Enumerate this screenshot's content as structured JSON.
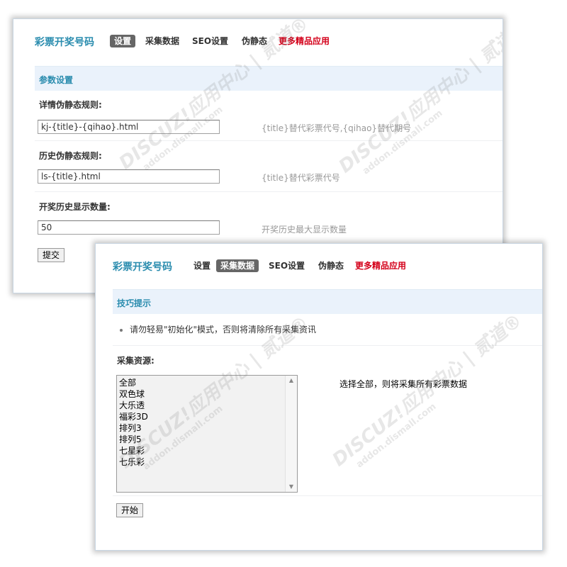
{
  "panel_settings": {
    "brand": "彩票开奖号码",
    "nav": [
      {
        "label": "设置",
        "active": true
      },
      {
        "label": "采集数据",
        "active": false
      },
      {
        "label": "SEO设置",
        "active": false
      },
      {
        "label": "伪静态",
        "active": false
      },
      {
        "label": "更多精品应用",
        "active": false,
        "promo": true
      }
    ],
    "section_title": "参数设置",
    "fields": [
      {
        "label": "详情伪静态规则:",
        "value": "kj-{title}-{qihao}.html",
        "hint": "{title}替代彩票代号,{qihao}替代期号"
      },
      {
        "label": "历史伪静态规则:",
        "value": "ls-{title}.html",
        "hint": "{title}替代彩票代号"
      },
      {
        "label": "开奖历史显示数量:",
        "value": "50",
        "hint": "开奖历史最大显示数量"
      }
    ],
    "submit_label": "提交"
  },
  "panel_collect": {
    "brand": "彩票开奖号码",
    "nav": [
      {
        "label": "设置",
        "active": false
      },
      {
        "label": "采集数据",
        "active": true
      },
      {
        "label": "SEO设置",
        "active": false
      },
      {
        "label": "伪静态",
        "active": false
      },
      {
        "label": "更多精品应用",
        "active": false,
        "promo": true
      }
    ],
    "section_title": "技巧提示",
    "tip": "请勿轻易\"初始化\"模式，否则将清除所有采集资讯",
    "source_label": "采集资源:",
    "source_options": [
      "全部",
      "双色球",
      "大乐透",
      "福彩3D",
      "排列3",
      "排列5",
      "七星彩",
      "七乐彩"
    ],
    "source_note": "选择全部，则将采集所有彩票数据",
    "start_label": "开始"
  },
  "watermark": {
    "brand": "DISCUZ!应用中心 | 贰道®",
    "url": "addon.dismall.com"
  },
  "colors": {
    "brand": "#2a8cae",
    "promo": "#d4001a",
    "active_tab": "#666666",
    "section_bg": "#eaf2fb"
  }
}
